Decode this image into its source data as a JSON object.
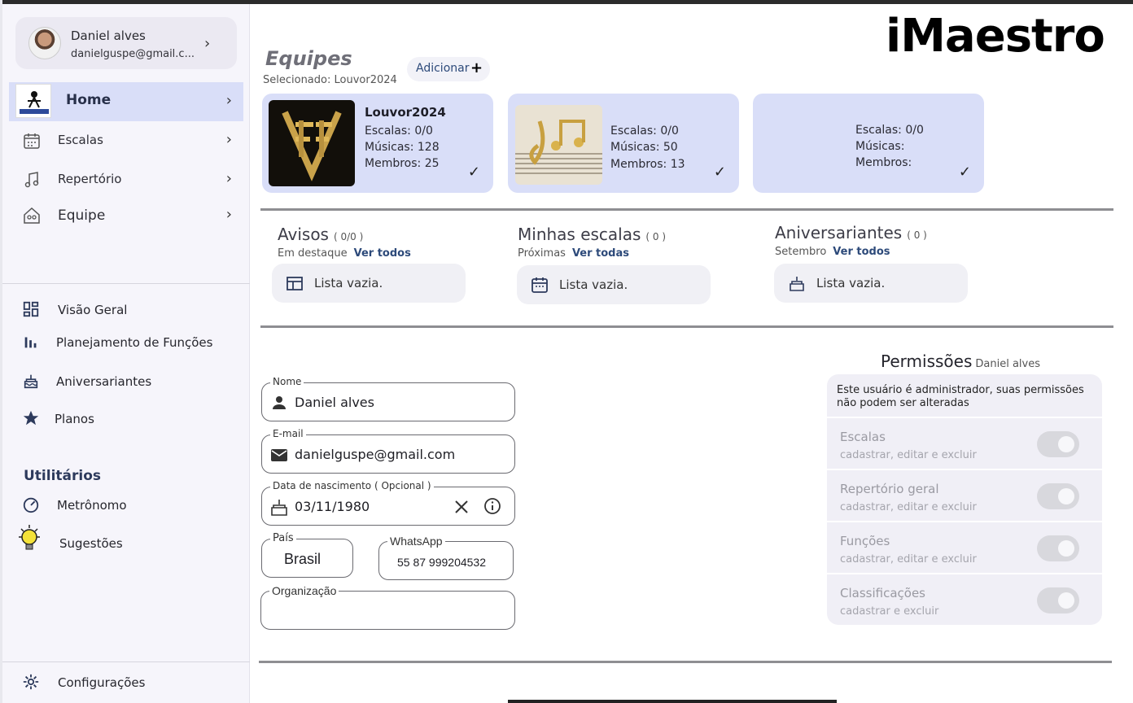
{
  "brand": "iMaestro",
  "user": {
    "name": "Daniel alves",
    "email": "danielguspe@gmail.c..."
  },
  "nav": [
    {
      "label": "Home",
      "active": true
    },
    {
      "label": "Escalas"
    },
    {
      "label": "Repertório"
    },
    {
      "label": "Equipe"
    }
  ],
  "tools": [
    {
      "label": "Visão Geral",
      "icon": "dashboard-icon"
    },
    {
      "label": "Planejamento de Funções",
      "icon": "bar-chart-icon"
    },
    {
      "label": "Aniversariantes",
      "icon": "cake-icon"
    },
    {
      "label": "Planos",
      "icon": "star-icon"
    }
  ],
  "utilities": {
    "title": "Utilitários",
    "items": [
      {
        "label": "Metrônomo",
        "icon": "speedometer-icon"
      },
      {
        "label": "Sugestões",
        "icon": "lightbulb-icon"
      }
    ]
  },
  "settings_label": "Configurações",
  "teams": {
    "title": "Equipes",
    "selected": "Selecionado: Louvor2024",
    "add_label": "Adicionar",
    "add_symbol": "+",
    "cards": [
      {
        "name": "Louvor2024",
        "escalas": "Escalas: 0/0",
        "musicas": "Músicas: 128",
        "membros": "Membros: 25"
      },
      {
        "name": "",
        "escalas": "Escalas: 0/0",
        "musicas": "Músicas: 50",
        "membros": "Membros: 13"
      },
      {
        "name": "",
        "escalas": "Escalas: 0/0",
        "musicas": "Músicas:",
        "membros": "Membros:"
      }
    ],
    "check_glyph": "✓"
  },
  "info": [
    {
      "title": "Avisos",
      "count": "( 0/0 )",
      "sub": "Em destaque",
      "link": "Ver todos",
      "empty": "Lista vazia."
    },
    {
      "title": "Minhas escalas",
      "count": "( 0 )",
      "sub": "Próximas",
      "link": "Ver todas",
      "empty": "Lista vazia."
    },
    {
      "title": "Aniversariantes",
      "count": "( 0 )",
      "sub": "Setembro",
      "link": "Ver todos",
      "empty": "Lista vazia."
    }
  ],
  "form": {
    "name": {
      "label": "Nome",
      "value": "Daniel alves"
    },
    "email": {
      "label": "E-mail",
      "value": "danielguspe@gmail.com"
    },
    "birth": {
      "label": "Data de nascimento ( Opcional )",
      "value": "03/11/1980"
    },
    "country": {
      "label": "País",
      "value": "Brasil"
    },
    "whatsapp": {
      "label": "WhatsApp",
      "value": "55 87 999204532"
    },
    "org": {
      "label": "Organização",
      "value": ""
    }
  },
  "permissions": {
    "title": "Permissões",
    "user": "Daniel alves",
    "note": "Este usuário é administrador, suas permissões não podem ser alteradas",
    "rows": [
      {
        "name": "Escalas",
        "desc": "cadastrar, editar e excluir"
      },
      {
        "name": "Repertório geral",
        "desc": "cadastrar, editar e excluir"
      },
      {
        "name": "Funções",
        "desc": "cadastrar, editar e excluir"
      },
      {
        "name": "Classificações",
        "desc": "cadastrar e excluir"
      }
    ]
  },
  "colors": {
    "accent": "#d9def8",
    "link": "#2d4a7a",
    "sidebar": "#f6f5fb"
  }
}
